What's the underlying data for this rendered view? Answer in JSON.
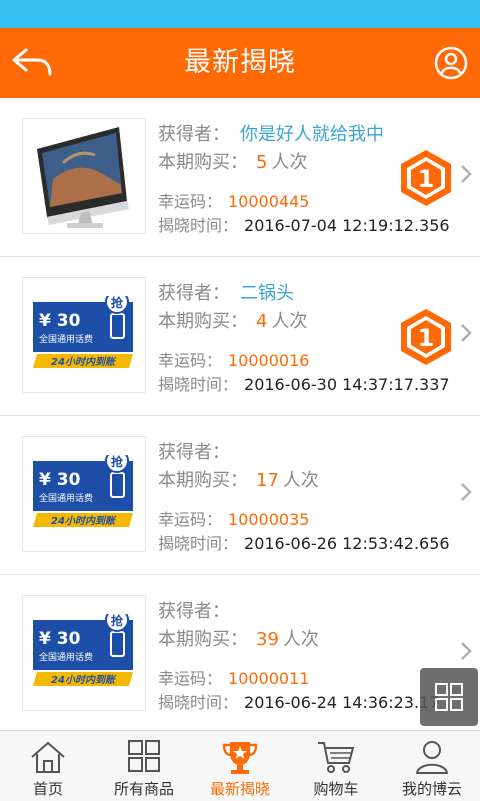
{
  "header": {
    "title": "最新揭晓"
  },
  "labels": {
    "winner": "获得者：",
    "purchase": "本期购买：",
    "lucky_code": "幸运码：",
    "reveal_time": "揭晓时间："
  },
  "items": [
    {
      "product": "imac",
      "winner": "你是好人就给我中",
      "count": "5",
      "unit": "人次",
      "code": "10000445",
      "time": "2016-07-04 12:19:12.356",
      "badge": "1"
    },
    {
      "product": "phone-card",
      "winner": "二锅头",
      "count": "4",
      "unit": "人次",
      "code": "10000016",
      "time": "2016-06-30 14:37:17.337",
      "badge": "1"
    },
    {
      "product": "phone-card",
      "winner": "",
      "count": "17",
      "unit": "人次",
      "code": "10000035",
      "time": "2016-06-26 12:53:42.656",
      "badge": ""
    },
    {
      "product": "phone-card",
      "winner": "",
      "count": "39",
      "unit": "人次",
      "code": "10000011",
      "time": "2016-06-24 14:36:23.17",
      "badge": ""
    }
  ],
  "card": {
    "amount": "¥ 30",
    "desc": "全国通用话费",
    "grab": "抢",
    "slogan": "24小时内到账"
  },
  "tabs": [
    {
      "label": "首页",
      "icon": "home-icon"
    },
    {
      "label": "所有商品",
      "icon": "grid-icon"
    },
    {
      "label": "最新揭晓",
      "icon": "trophy-icon",
      "active": true
    },
    {
      "label": "购物车",
      "icon": "cart-icon"
    },
    {
      "label": "我的博云",
      "icon": "user-icon"
    }
  ],
  "colors": {
    "accent": "#ff6a06",
    "statusbar": "#33bff0",
    "link": "#3aa5d8"
  }
}
